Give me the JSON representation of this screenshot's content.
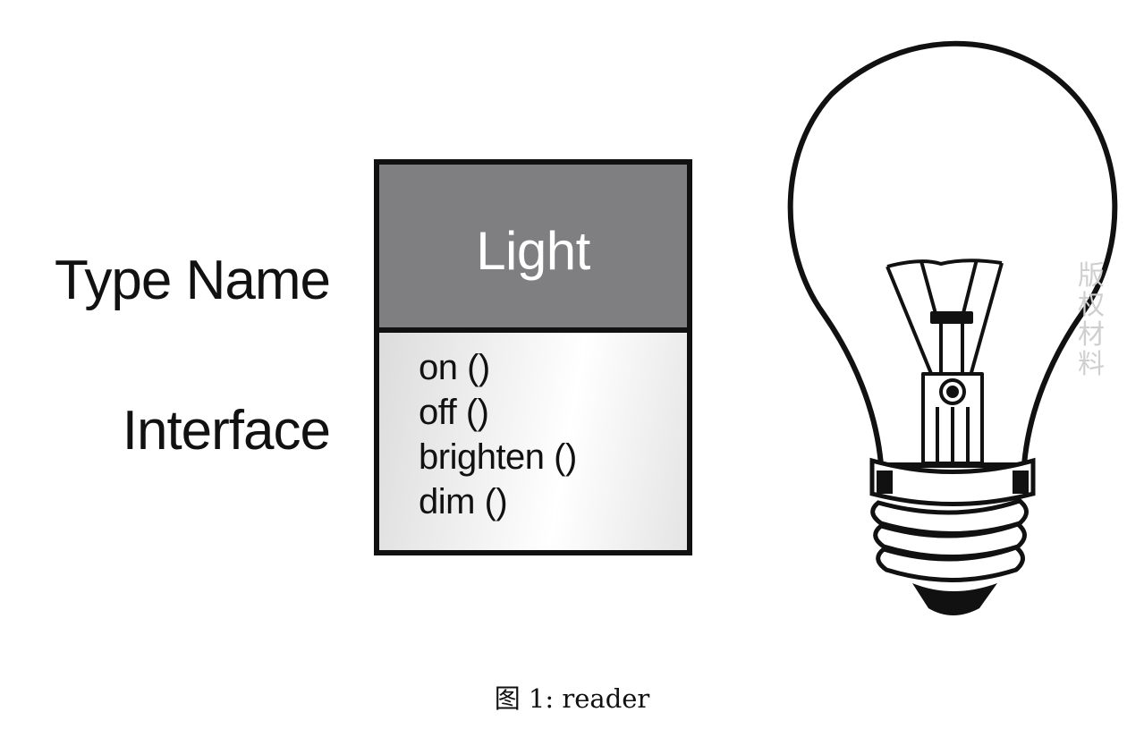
{
  "labels": {
    "type_name": "Type Name",
    "interface": "Interface"
  },
  "uml": {
    "type_name": "Light",
    "methods": [
      "on ()",
      "off ()",
      "brighten ()",
      "dim ()"
    ]
  },
  "bulb": {
    "icon": "light-bulb-icon"
  },
  "watermark": "版权材料",
  "caption": "图 1: reader",
  "colors": {
    "header_fill": "#7f7f82",
    "outline": "#111111",
    "watermark": "#cfcfcf"
  }
}
